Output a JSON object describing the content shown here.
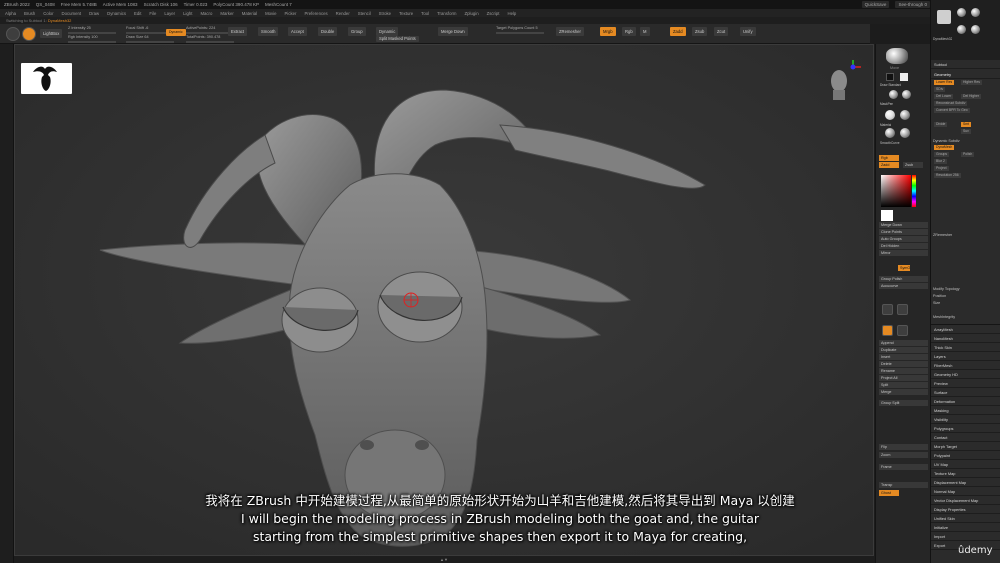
{
  "titlebar": {
    "app": "ZBrush 2022",
    "file": "QS_0408",
    "stats": [
      "Free Mem 5.748B",
      "Active Mem 1083",
      "Scratch Disk 106",
      "Timer 0.023",
      "PolyCount 390.478 KP",
      "MeshCount 7"
    ],
    "quicksave": "QuickSave",
    "seethrough": "See-through 0",
    "menus_label": "Menus",
    "script": "DefaultZScript"
  },
  "menubar": [
    "Alpha",
    "Brush",
    "Color",
    "Document",
    "Draw",
    "Dynamics",
    "Edit",
    "File",
    "Layer",
    "Light",
    "Macro",
    "Marker",
    "Material",
    "Movie",
    "Picker",
    "Preferences",
    "Render",
    "Stencil",
    "Stroke",
    "Texture",
    "Tool",
    "Transform",
    "Zplugin",
    "Zscript",
    "Help"
  ],
  "subline": {
    "prefix": "Switching to Subtool 1:",
    "name": "DynaMesh32"
  },
  "toolbar": {
    "buttons": [
      "Edit",
      "Draw",
      "Move",
      "Scale",
      "Rotate"
    ],
    "lightbox": "LightBox",
    "sliders": [
      {
        "label": "Z Intensity 25",
        "pct": 0.25
      },
      {
        "label": "Focal Shift -6",
        "pct": 0.45
      },
      {
        "label": "Draw Size 64",
        "pct": 0.3
      },
      {
        "label": "ActivePoints: 224",
        "pct": 0
      },
      {
        "label": "TotalPoints: 390.478",
        "pct": 0
      }
    ],
    "rgb_intensity": "Rgb Intensity 100",
    "dynamic": "Dynamic",
    "mrgb": [
      "Mrgb",
      "Rgb",
      "M"
    ],
    "zadd": "Zadd",
    "zsub": "Zsub",
    "zcut": "Zcut",
    "actions": [
      "Extract",
      "Smooth",
      "Accept",
      "Double",
      "Group",
      "Dynamic",
      "Split Masked Points",
      "Merge Down",
      "Target Polygons Count 5",
      "ZRemesher",
      "Unify"
    ]
  },
  "right_tray": {
    "items": [
      "Move",
      "Draw Standard",
      "MaskPen",
      "Material",
      "SmoothCurve",
      "Polyp",
      "Fill",
      "Rgb",
      "Zadd",
      "Zsub",
      "Merge Down",
      "Clone Points",
      "Auto Groups",
      "Del Hidden",
      "Mirror",
      "SymOfs",
      "Group Polish",
      "Accucurve",
      "Edit",
      "Draw",
      "Projection",
      "Append",
      "Duplicate",
      "Insert",
      "Delete",
      "Rename",
      "Project All",
      "Split",
      "Merge",
      "Group Split",
      "Flip",
      "Zoom",
      "Frame",
      "Transp",
      "Ghost"
    ],
    "colors": {
      "accent": "#e58a22"
    }
  },
  "panel": {
    "tool_name": "DynaMesh32",
    "subtool": "Subtool",
    "geometry": "Geometry",
    "lower_res": "Lower Res",
    "higher_res": "Higher Res",
    "sdiv": "SDiv",
    "delete_lower": "Del Lower",
    "delete_higher": "Del Higher",
    "reconstruct": "Reconstruct Subdiv",
    "convert_bpr": "Convert BPR To Geo",
    "divide": "Divide",
    "smt": "Smt",
    "suv": "Suv",
    "dynamic_subdiv": "Dynamic Subdiv",
    "dynamesh": "DynaMesh",
    "resolution": "Resolution 256",
    "groups": "Groups",
    "polish": "Polish",
    "blur": "Blur 2",
    "project": "Project",
    "zremesher": "ZRemesher",
    "modify_topology": "Modify Topology",
    "position": "Position",
    "size": "Size",
    "meshintegrity": "MeshIntegrity",
    "list": [
      "ArrayMesh",
      "NanoMesh",
      "Thick Skin",
      "Layers",
      "FiberMesh",
      "Geometry HD",
      "Preview",
      "Surface",
      "Deformation",
      "Masking",
      "Visibility",
      "Polygroups",
      "Contact",
      "Morph Target",
      "Polypaint",
      "UV Map",
      "Texture Map",
      "Displacement Map",
      "Normal Map",
      "Vector Displacement Map",
      "Display Properties",
      "Unified Skin",
      "Initialize",
      "Import",
      "Export"
    ]
  },
  "subtitles": {
    "zh": "我将在 ZBrush 中开始建模过程,从最简单的原始形状开始为山羊和吉他建模,然后将其导出到 Maya 以创建",
    "en1": "I will begin the modeling process in ZBrush modeling both the goat and, the guitar",
    "en2": "starting from the simplest primitive shapes then export it to Maya for creating,"
  },
  "watermark": "ûdemy",
  "bottom_label": "▲▼"
}
